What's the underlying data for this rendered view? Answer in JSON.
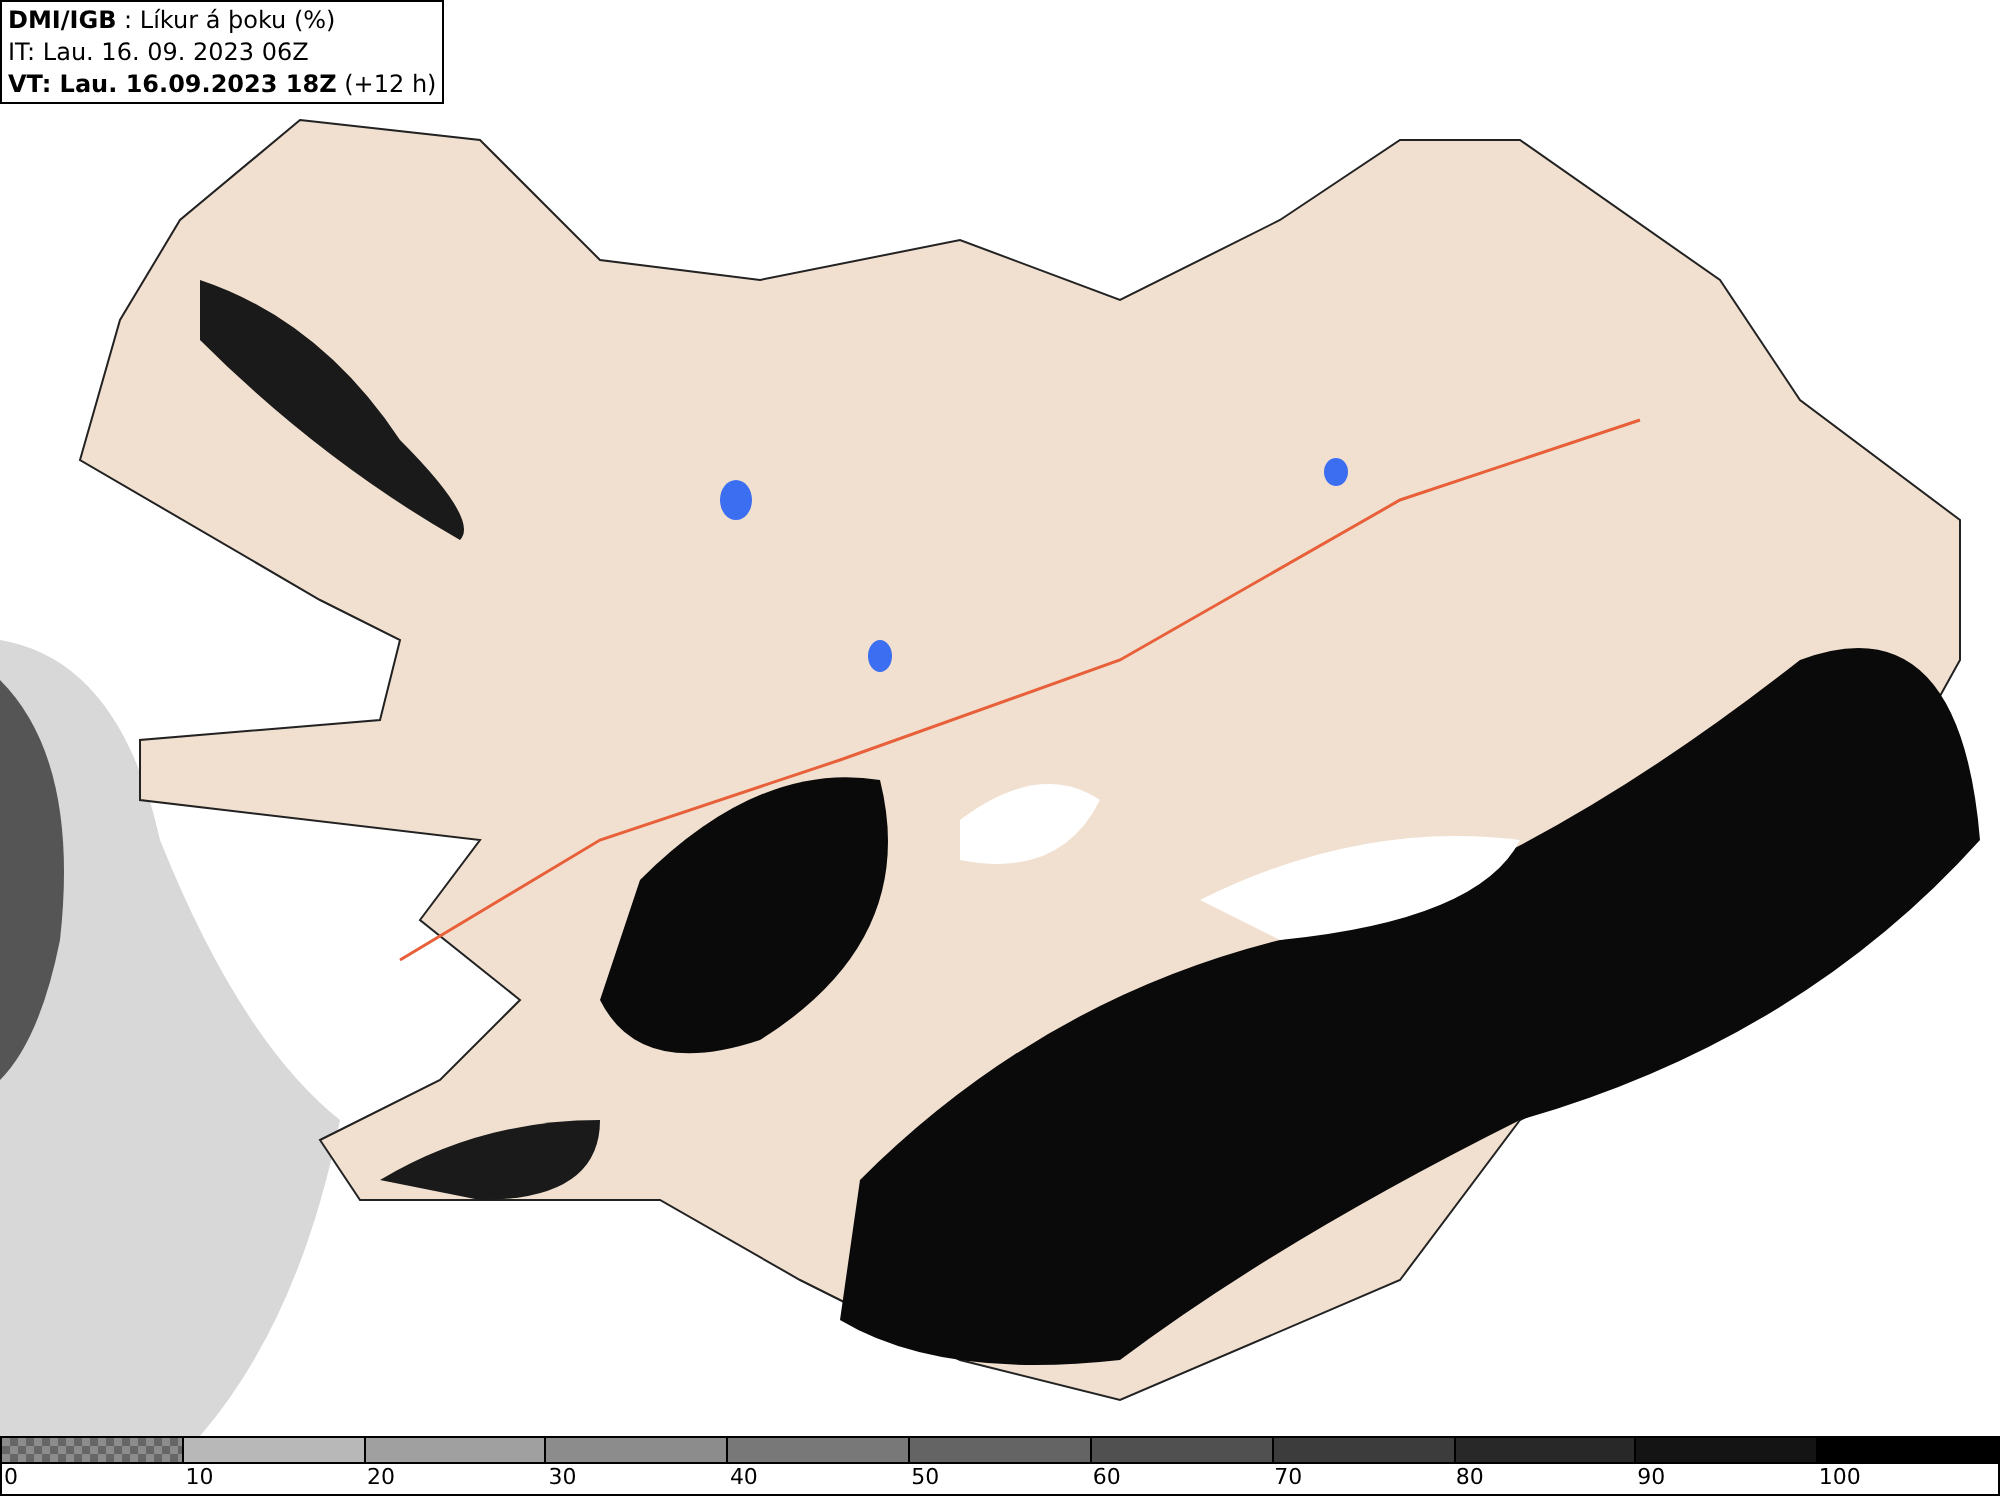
{
  "info_box": {
    "lines": [
      "**DMI/IGB** : Líkur á þoku (%)",
      "IT: Lau. 16. 09. 2023 06Z",
      "**VT: Lau. 16.09.2023 18Z** (+12 h)"
    ]
  },
  "legend": {
    "segments": [
      {
        "kind": "checker",
        "color": "#8c8c8c"
      },
      {
        "kind": "solid",
        "color": "#b8b8b8"
      },
      {
        "kind": "solid",
        "color": "#a0a0a0"
      },
      {
        "kind": "solid",
        "color": "#8c8c8c"
      },
      {
        "kind": "solid",
        "color": "#787878"
      },
      {
        "kind": "solid",
        "color": "#646464"
      },
      {
        "kind": "solid",
        "color": "#505050"
      },
      {
        "kind": "solid",
        "color": "#3c3c3c"
      },
      {
        "kind": "solid",
        "color": "#282828"
      },
      {
        "kind": "solid",
        "color": "#141414"
      },
      {
        "kind": "solid",
        "color": "#000000"
      }
    ],
    "labels": [
      "0",
      "10",
      "20",
      "30",
      "40",
      "50",
      "60",
      "70",
      "80",
      "90",
      "100"
    ]
  }
}
